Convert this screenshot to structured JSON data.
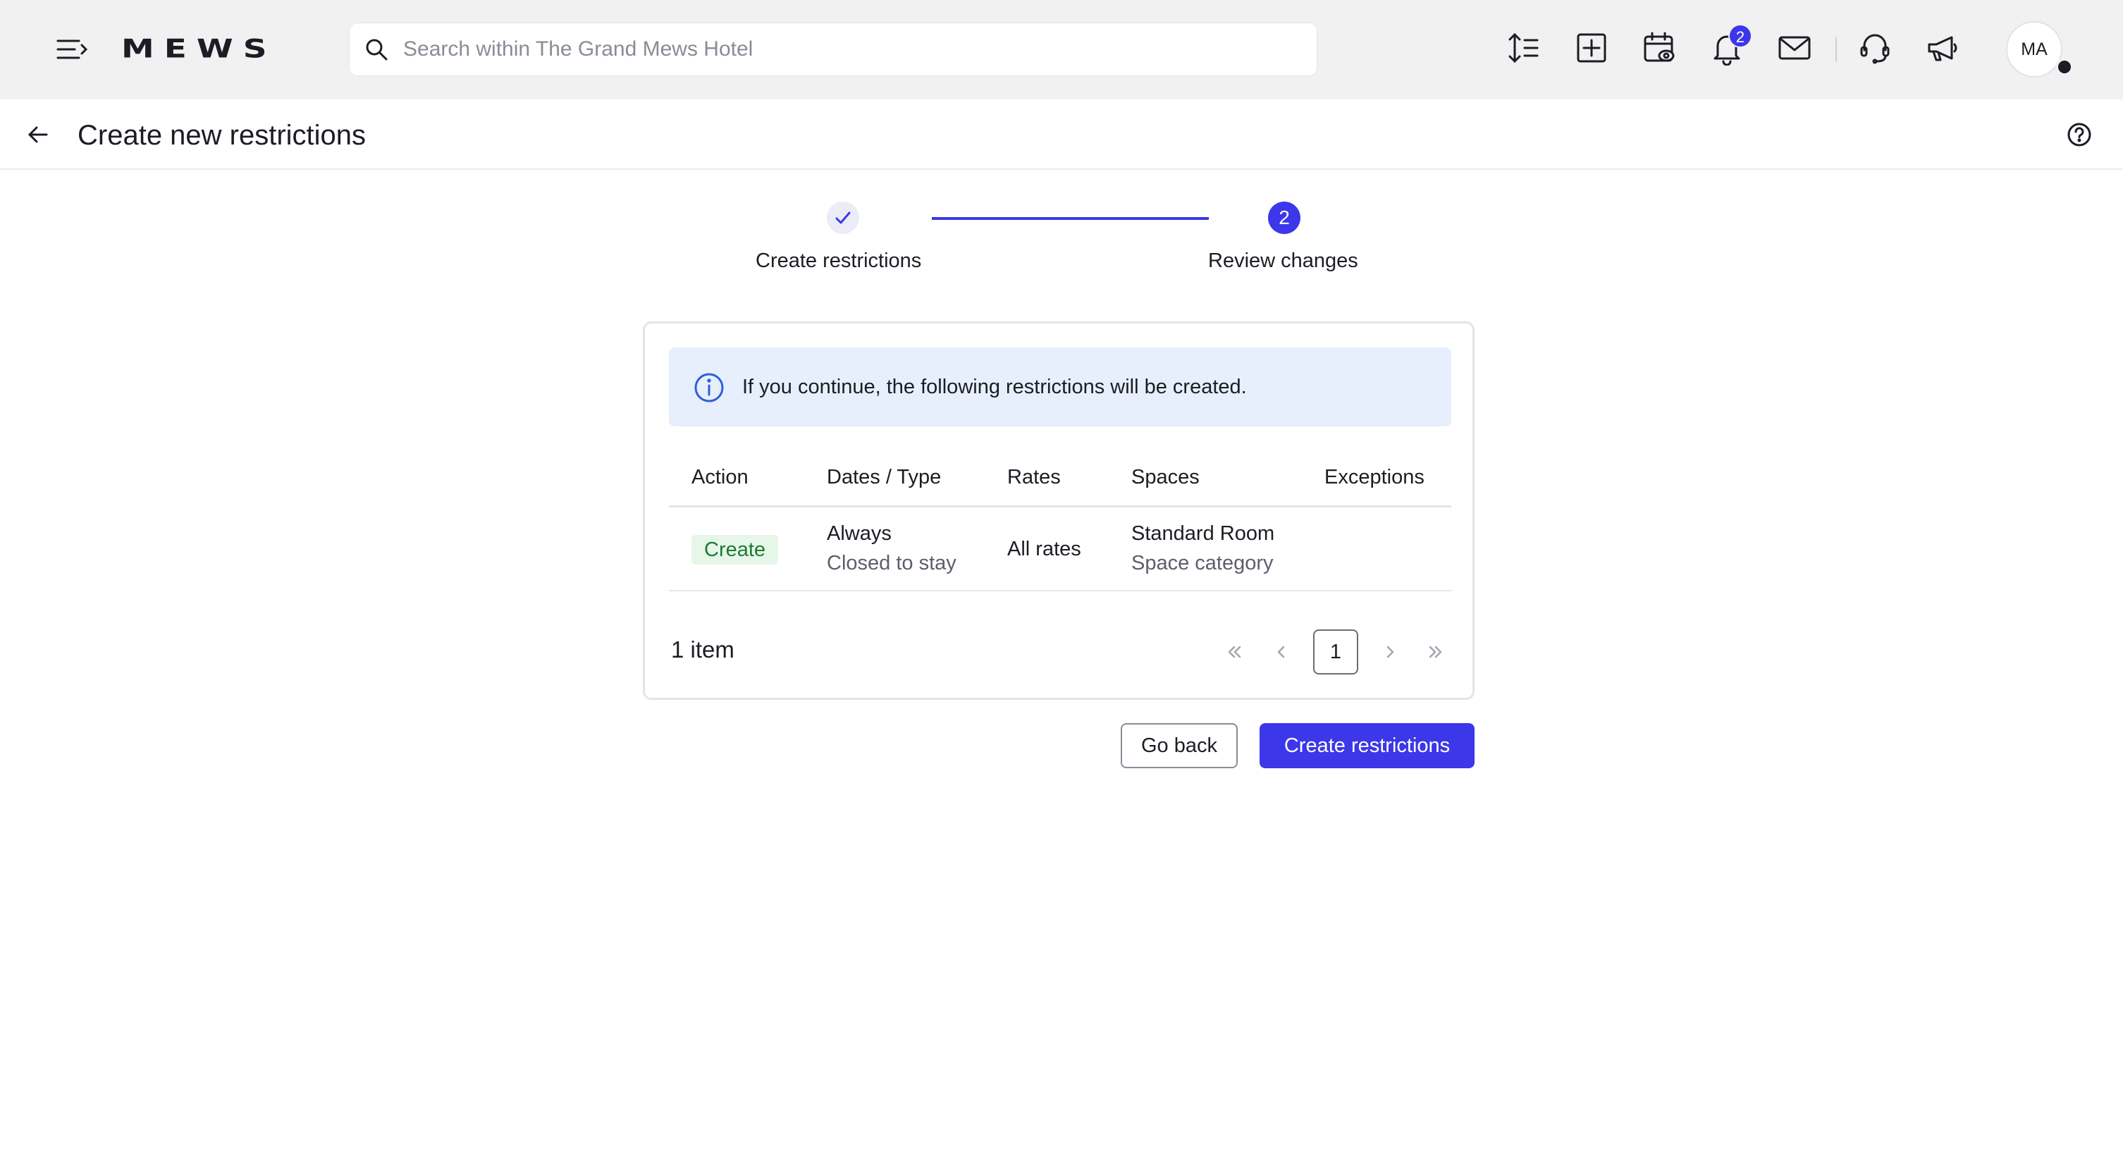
{
  "topbar": {
    "logo": "MEWS",
    "search_placeholder": "Search within The Grand Mews Hotel",
    "icons": [
      "menu-icon",
      "line-spacing-icon",
      "add-square-icon",
      "calendar-view-icon",
      "bell-icon",
      "mail-icon",
      "support-headset-icon",
      "megaphone-icon"
    ],
    "notification_count": "2",
    "avatar_initials": "MA"
  },
  "header": {
    "title": "Create new restrictions"
  },
  "stepper": {
    "steps": [
      {
        "label": "Create restrictions",
        "state": "completed"
      },
      {
        "label": "Review changes",
        "number": "2",
        "state": "current"
      }
    ]
  },
  "info": {
    "message": "If you continue, the following restrictions will be created."
  },
  "table": {
    "columns": [
      "Action",
      "Dates / Type",
      "Rates",
      "Spaces",
      "Exceptions"
    ],
    "rows": [
      {
        "action": "Create",
        "dates": "Always",
        "type": "Closed to stay",
        "rates": "All rates",
        "space": "Standard Room",
        "space_type": "Space category",
        "exceptions": ""
      }
    ]
  },
  "pagination": {
    "item_count": "1 item",
    "current_page": "1"
  },
  "actions": {
    "back_label": "Go back",
    "submit_label": "Create restrictions"
  },
  "colors": {
    "accent": "#3c37e8",
    "info_bg": "#e7effd",
    "tag_bg": "#e6f6e9",
    "tag_text": "#1e7a33"
  }
}
